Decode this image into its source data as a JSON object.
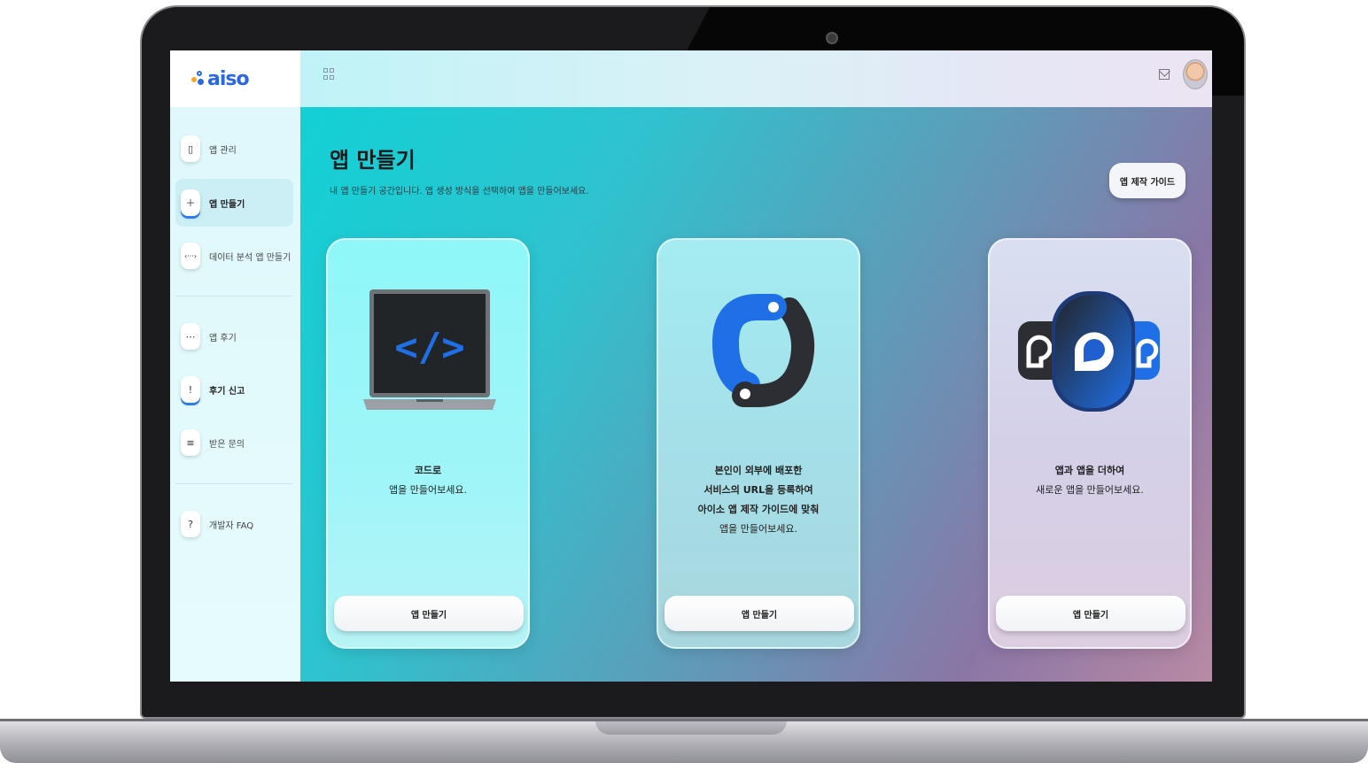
{
  "app": {
    "logo_text": "aiso",
    "colors": {
      "brand": "#2b67e0",
      "accent": "#2f7de8"
    }
  },
  "topbar": {
    "apps_icon": "grid-icon",
    "mail_icon": "mail-icon"
  },
  "sidebar": {
    "items": [
      {
        "label": "앱 관리",
        "icon": "phone-vibrate-icon",
        "glyph": "▯"
      },
      {
        "label": "앱 만들기",
        "icon": "add-image-icon",
        "glyph": "＋"
      },
      {
        "label": "데이터 분석 앱 만들기",
        "icon": "code-arrows-icon",
        "glyph": "‹···›"
      },
      {
        "label": "앱 후기",
        "icon": "chat-icon",
        "glyph": "⋯"
      },
      {
        "label": "후기 신고",
        "icon": "alert-icon",
        "glyph": "!"
      },
      {
        "label": "받은 문의",
        "icon": "document-icon",
        "glyph": "≡"
      },
      {
        "label": "개발자 FAQ",
        "icon": "help-icon",
        "glyph": "?"
      }
    ]
  },
  "main": {
    "title": "앱 만들기",
    "description": "내 앱 만들기 공간입니다. 앱 생성 방식을 선택하여 앱을 만들어보세요.",
    "guide_button": "앱 제작 가이드",
    "cards": [
      {
        "lines": [
          "코드로",
          "앱을 만들어보세요."
        ],
        "button": "앱 만들기",
        "illustration": "laptop-code-icon"
      },
      {
        "lines": [
          "본인이 외부에 배포한",
          "서비스의 URL을 등록하여",
          "아이소 앱 제작 가이드에 맞춰",
          "앱을 만들어보세요."
        ],
        "button": "앱 만들기",
        "illustration": "link-pipe-icon"
      },
      {
        "lines": [
          "앱과 앱을 더하여",
          "새로운 앱을 만들어보세요."
        ],
        "button": "앱 만들기",
        "illustration": "app-merge-icon"
      }
    ]
  }
}
